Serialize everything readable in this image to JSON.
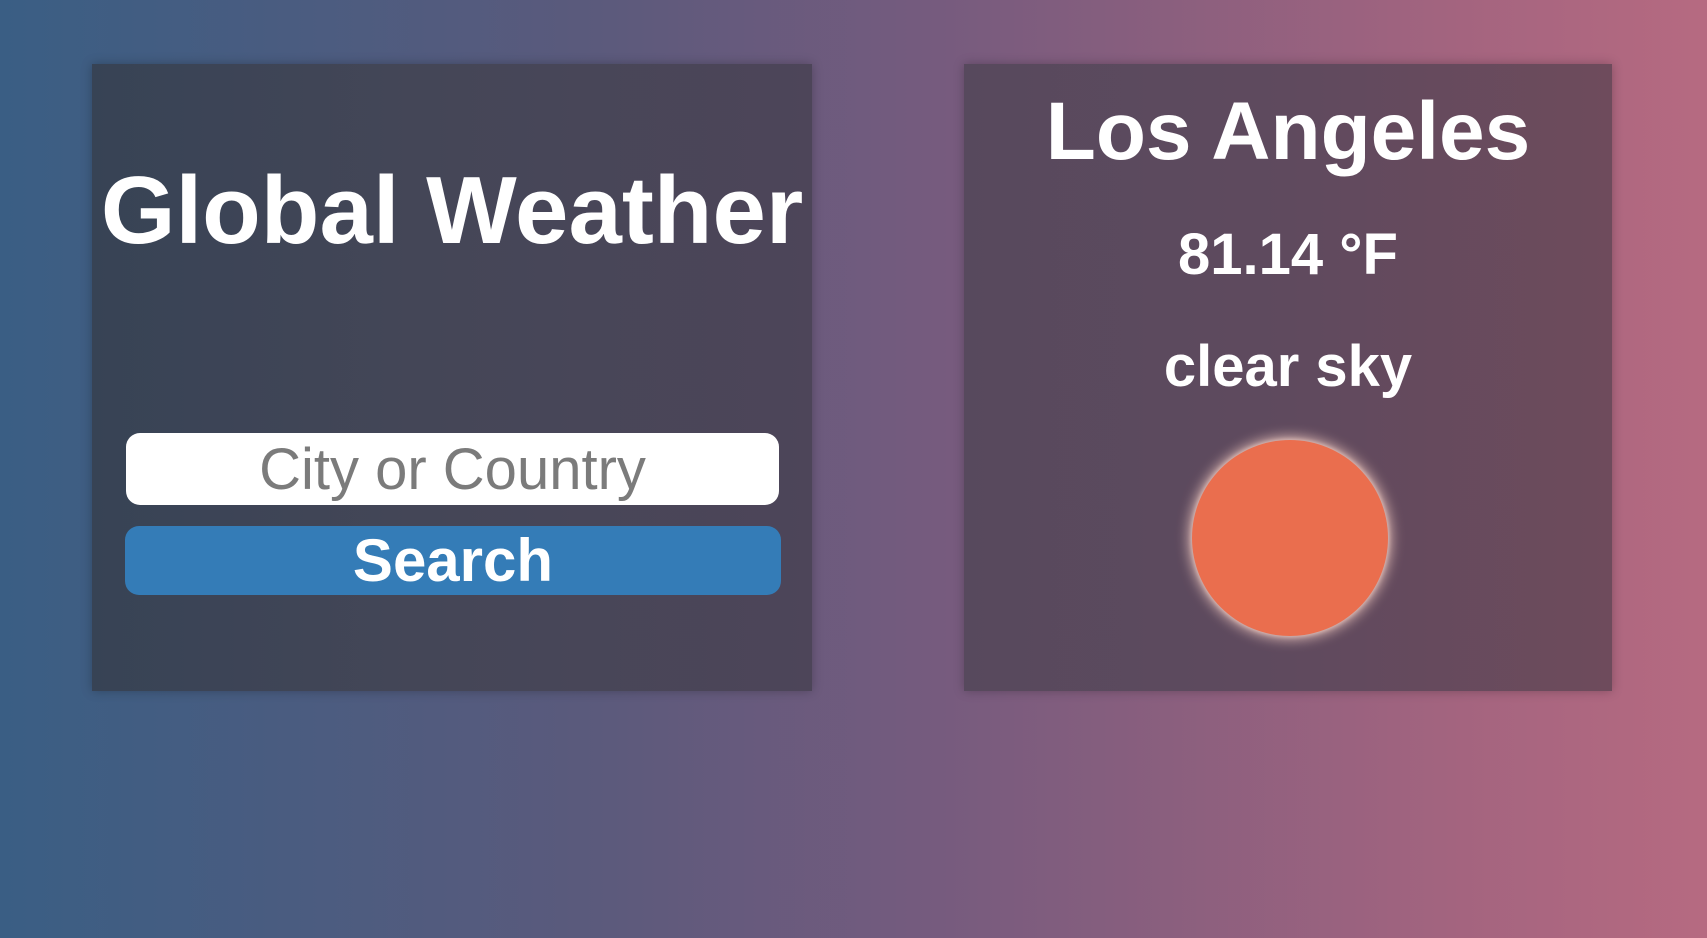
{
  "search_panel": {
    "title": "Global Weather",
    "input_placeholder": "City or Country",
    "input_value": "",
    "search_label": "Search"
  },
  "weather_panel": {
    "city": "Los Angeles",
    "temperature": "81.14 °F",
    "description": "clear sky",
    "icon": "sun-icon"
  },
  "colors": {
    "accent": "#347cb7",
    "sun": "#ea6e4e"
  }
}
